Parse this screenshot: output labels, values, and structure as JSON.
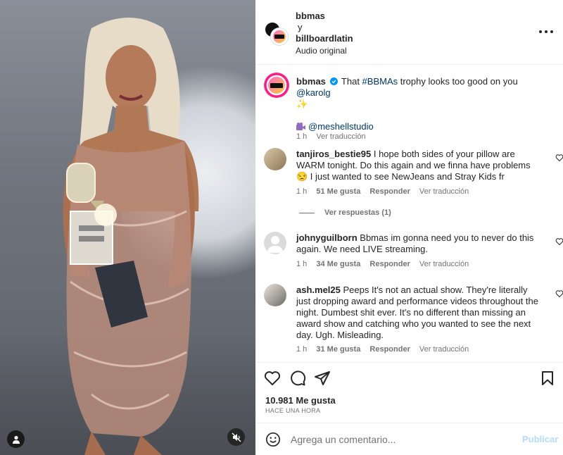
{
  "header": {
    "user1": "bbmas",
    "and": "y",
    "user2": "billboardlatin",
    "audio": "Audio original"
  },
  "caption": {
    "username": "bbmas",
    "text_before": "That ",
    "hashtag": "#BBMAs",
    "text_mid": " trophy looks too good on you ",
    "mention": "@karolg",
    "sparkle": "✨",
    "credit": "@meshellstudio",
    "time": "1 h",
    "translate": "Ver traducción"
  },
  "comments": [
    {
      "username": "tanjiros_bestie95",
      "text": "I hope both sides of your pillow are WARM tonight. Do this again and we finna have problems😒 I just wanted to see NewJeans and Stray Kids fr",
      "time": "1 h",
      "likes": "51 Me gusta",
      "reply": "Responder",
      "translate": "Ver traducción",
      "replies": "Ver respuestas (1)"
    },
    {
      "username": "johnyguilborn",
      "text": "Bbmas im gonna need you to never do this again. We need LIVE streaming.",
      "time": "1 h",
      "likes": "34 Me gusta",
      "reply": "Responder",
      "translate": "Ver traducción"
    },
    {
      "username": "ash.mel25",
      "text": "Peeps It's not an actual show. They're literally just dropping award and performance videos throughout the night. Dumbest shit ever. It's no different than missing an award show and catching who you wanted to see the next day. Ugh. Misleading.",
      "time": "1 h",
      "likes": "31 Me gusta",
      "reply": "Responder",
      "translate": "Ver traducción"
    }
  ],
  "footer": {
    "likes": "10.981 Me gusta",
    "time": "HACE UNA HORA",
    "comment_placeholder": "Agrega un comentario...",
    "post": "Publicar"
  },
  "colors": {
    "link": "#00376b",
    "verified": "#0095f6",
    "muted": "#737373",
    "post_disabled": "#b3dbff"
  }
}
